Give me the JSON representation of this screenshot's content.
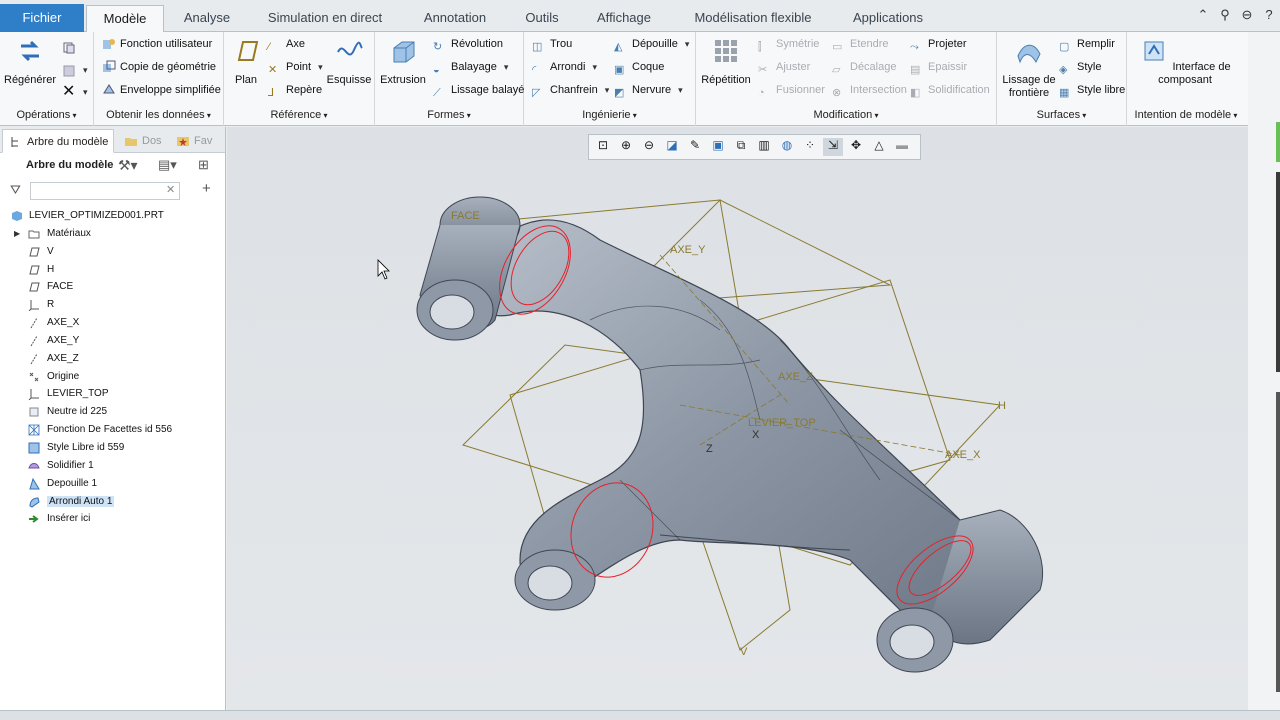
{
  "menubar": {
    "file": "Fichier",
    "tabs": [
      "Modèle",
      "Analyse",
      "Simulation en direct",
      "Annotation",
      "Outils",
      "Affichage",
      "Modélisation flexible",
      "Applications"
    ]
  },
  "ribbon": {
    "operations": {
      "label": "Opérations",
      "regen": "Régénérer"
    },
    "getdata": {
      "label": "Obtenir les données",
      "items": [
        "Fonction utilisateur",
        "Copie de géométrie",
        "Enveloppe simplifiée"
      ]
    },
    "reference": {
      "label": "Référence",
      "plan": "Plan",
      "axe": "Axe",
      "point": "Point",
      "repere": "Repère",
      "esquisse": "Esquisse"
    },
    "formes": {
      "label": "Formes",
      "extrusion": "Extrusion",
      "revolution": "Révolution",
      "balayage": "Balayage",
      "lissage": "Lissage balayé"
    },
    "ingenierie": {
      "label": "Ingénierie",
      "trou": "Trou",
      "arrondi": "Arrondi",
      "chanfrein": "Chanfrein",
      "depouille": "Dépouille",
      "coque": "Coque",
      "nervure": "Nervure"
    },
    "modification": {
      "label": "Modification",
      "repetition": "Répétition",
      "symetrie": "Symétrie",
      "ajuster": "Ajuster",
      "fusionner": "Fusionner",
      "etendre": "Etendre",
      "decalage": "Décalage",
      "intersection": "Intersection",
      "projeter": "Projeter",
      "epaissir": "Epaissir",
      "solidification": "Solidification"
    },
    "surfaces": {
      "label": "Surfaces",
      "lissage_frontiere": "Lissage de frontière",
      "remplir": "Remplir",
      "style": "Style",
      "style_libre": "Style libre"
    },
    "intention": {
      "label": "Intention de modèle",
      "interface": "Interface de composant"
    }
  },
  "panel": {
    "tabs": [
      "Arbre du modèle",
      "Dos",
      "Fav"
    ],
    "tree_title": "Arbre du modèle",
    "root": "LEVIER_OPTIMIZED001.PRT",
    "nodes": [
      {
        "label": "Matériaux",
        "icon": "folder-icon"
      },
      {
        "label": "V",
        "icon": "datum-plane-icon"
      },
      {
        "label": "H",
        "icon": "datum-plane-icon"
      },
      {
        "label": "FACE",
        "icon": "datum-plane-icon"
      },
      {
        "label": "R",
        "icon": "coordinate-system-icon"
      },
      {
        "label": "AXE_X",
        "icon": "datum-axis-icon"
      },
      {
        "label": "AXE_Y",
        "icon": "datum-axis-icon"
      },
      {
        "label": "AXE_Z",
        "icon": "datum-axis-icon"
      },
      {
        "label": "Origine",
        "icon": "datum-point-icon"
      },
      {
        "label": "LEVIER_TOP",
        "icon": "coordinate-system-icon"
      },
      {
        "label": "Neutre id 225",
        "icon": "feature-icon"
      },
      {
        "label": "Fonction De Facettes id 556",
        "icon": "facet-icon"
      },
      {
        "label": "Style Libre id 559",
        "icon": "freestyle-icon"
      },
      {
        "label": "Solidifier 1",
        "icon": "solidify-icon"
      },
      {
        "label": "Depouille 1",
        "icon": "draft-icon"
      },
      {
        "label": "Arrondi Auto 1",
        "icon": "round-icon"
      },
      {
        "label": "Insérer ici",
        "icon": "insert-arrow-icon"
      }
    ]
  },
  "viewport": {
    "labels": {
      "face": "FACE",
      "axe_y": "AXE_Y",
      "axe_z": "AXE_Z",
      "axe_x": "AXE_X",
      "levier_top": "LEVIER_TOP",
      "h": "H",
      "v": "V",
      "z": "Z",
      "x": "X"
    }
  },
  "colors": {
    "accent": "#2f7fc8",
    "model": "#8c96a4",
    "edges": "#e8202a",
    "datum": "#8a7a30"
  }
}
